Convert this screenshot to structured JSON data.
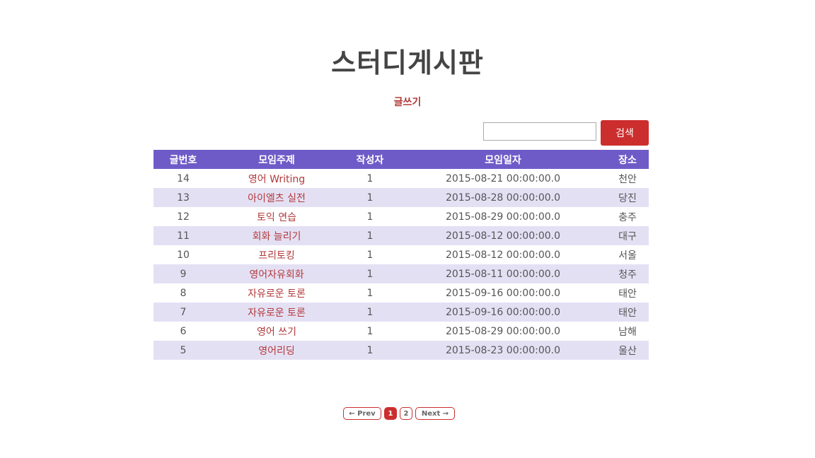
{
  "page": {
    "title": "스터디게시판",
    "write_label": "글쓰기"
  },
  "search": {
    "value": "",
    "placeholder": "",
    "button_label": "검색"
  },
  "table": {
    "headers": {
      "no": "글번호",
      "topic": "모임주제",
      "writer": "작성자",
      "date": "모임일자",
      "place": "장소"
    },
    "rows": [
      {
        "no": "14",
        "topic": "영어 Writing",
        "writer": "1",
        "date": "2015-08-21 00:00:00.0",
        "place": "천안"
      },
      {
        "no": "13",
        "topic": "아이엘츠 실전",
        "writer": "1",
        "date": "2015-08-28 00:00:00.0",
        "place": "당진"
      },
      {
        "no": "12",
        "topic": "토익 연습",
        "writer": "1",
        "date": "2015-08-29 00:00:00.0",
        "place": "충주"
      },
      {
        "no": "11",
        "topic": "회화 늘리기",
        "writer": "1",
        "date": "2015-08-12 00:00:00.0",
        "place": "대구"
      },
      {
        "no": "10",
        "topic": "프리토킹",
        "writer": "1",
        "date": "2015-08-12 00:00:00.0",
        "place": "서울"
      },
      {
        "no": "9",
        "topic": "영어자유회화",
        "writer": "1",
        "date": "2015-08-11 00:00:00.0",
        "place": "청주"
      },
      {
        "no": "8",
        "topic": "자유로운 토론",
        "writer": "1",
        "date": "2015-09-16 00:00:00.0",
        "place": "태안"
      },
      {
        "no": "7",
        "topic": "자유로운 토론",
        "writer": "1",
        "date": "2015-09-16 00:00:00.0",
        "place": "태안"
      },
      {
        "no": "6",
        "topic": "영어 쓰기",
        "writer": "1",
        "date": "2015-08-29 00:00:00.0",
        "place": "남해"
      },
      {
        "no": "5",
        "topic": "영어리딩",
        "writer": "1",
        "date": "2015-08-23 00:00:00.0",
        "place": "울산"
      }
    ]
  },
  "pagination": {
    "prev_label": "← Prev",
    "pages": [
      "1",
      "2"
    ],
    "current": "1",
    "next_label": "Next →"
  },
  "colors": {
    "header_bg": "#6f5bc8",
    "row_alt_bg": "#e4e0f4",
    "accent": "#cc2e2e",
    "link": "#b23a3a"
  }
}
